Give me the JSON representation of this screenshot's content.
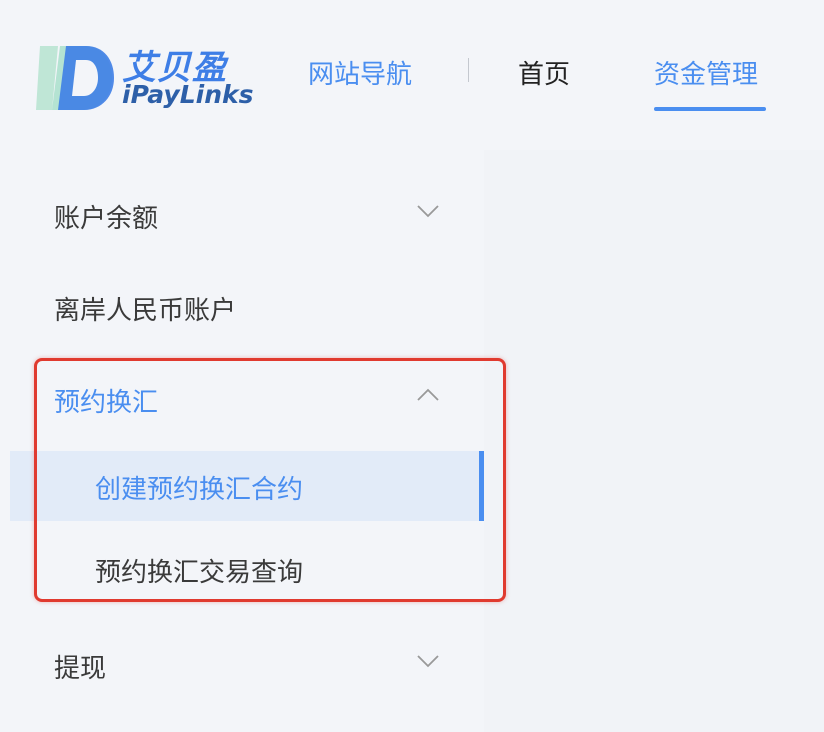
{
  "brand": {
    "name_cn": "艾贝盈",
    "name_en": "iPayLinks",
    "colors": {
      "primary": "#4a8ef0",
      "dark_blue": "#2d5fa8",
      "highlight_red": "#e03a2f"
    }
  },
  "header": {
    "nav": [
      {
        "label": "网站导航"
      },
      {
        "label": "首页"
      },
      {
        "label": "资金管理",
        "active": true
      }
    ]
  },
  "sidebar": {
    "items": [
      {
        "label": "账户余额",
        "icon": "chevron-down-icon",
        "expanded": false
      },
      {
        "label": "离岸人民币账户"
      },
      {
        "label": "预约换汇",
        "icon": "chevron-up-icon",
        "expanded": true,
        "children": [
          {
            "label": "创建预约换汇合约",
            "active": true
          },
          {
            "label": "预约换汇交易查询"
          }
        ]
      },
      {
        "label": "提现",
        "icon": "chevron-down-icon",
        "expanded": false
      }
    ]
  }
}
